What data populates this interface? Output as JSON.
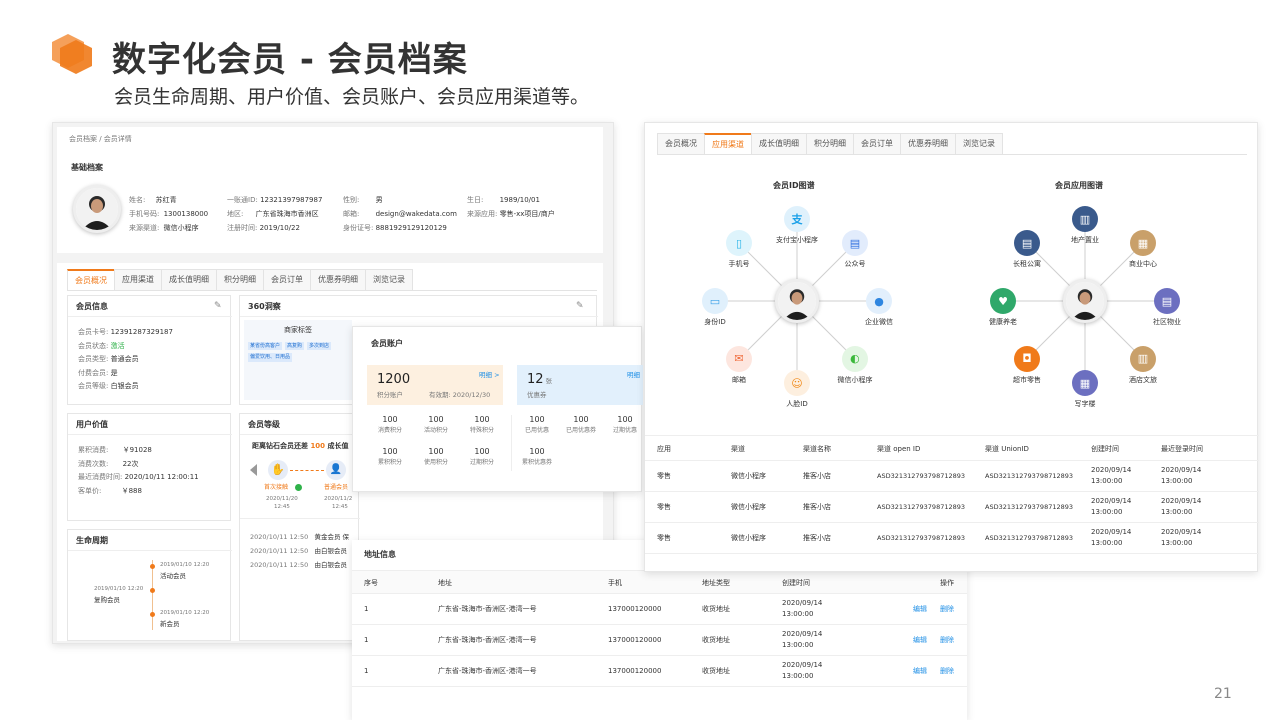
{
  "slide": {
    "title": "数字化会员 - 会员档案",
    "subtitle": "会员生命周期、用户价值、会员账户、会员应用渠道等。",
    "page_number": "21",
    "accent": "#f07a1a"
  },
  "left": {
    "breadcrumb": "会员档案 / 会员详情",
    "basic_title": "基础档案",
    "profile": {
      "name_label": "姓名:",
      "name": "苏红青",
      "phone_label": "手机号码:",
      "phone": "1300138000",
      "source_label": "来源渠道:",
      "source": "微信小程序",
      "id_label": "一账通ID:",
      "id": "12321397987987",
      "region_label": "地区:",
      "region": "广东省珠海市香洲区",
      "reg_label": "注册时间:",
      "reg": "2019/10/22",
      "gender_label": "性别:",
      "gender": "男",
      "email_label": "邮箱:",
      "email": "design@wakedata.com",
      "idcard_label": "身份证号:",
      "idcard": "8881929129120129",
      "birth_label": "生日:",
      "birth": "1989/10/01",
      "app_label": "来源应用:",
      "app": "零售-xx项目/商户"
    },
    "tabs": [
      "会员概况",
      "应用渠道",
      "成长值明细",
      "积分明细",
      "会员订单",
      "优惠券明细",
      "浏览记录"
    ],
    "member_info": {
      "title": "会员信息",
      "rows": [
        {
          "k": "会员卡号:",
          "v": "12391287329187"
        },
        {
          "k": "会员状态:",
          "v": "激活"
        },
        {
          "k": "会员类型:",
          "v": "普通会员"
        },
        {
          "k": "付费会员:",
          "v": "是"
        },
        {
          "k": "会员等级:",
          "v": "白银会员"
        }
      ]
    },
    "insight": {
      "title": "360洞察",
      "tag_title": "商家标签",
      "tags": [
        "某省份高客户",
        "高复购",
        "多次到店",
        "偏爱饮用、日用品"
      ]
    },
    "user_value": {
      "title": "用户价值",
      "rows": [
        {
          "k": "累积消费:",
          "v": "￥91028"
        },
        {
          "k": "消费次数:",
          "v": "22次"
        },
        {
          "k": "最近消费时间:",
          "v": "2020/10/11 12:00:11"
        },
        {
          "k": "客单价:",
          "v": "￥888"
        }
      ]
    },
    "level": {
      "title": "会员等级",
      "hint_prefix": "距离钻石会员还差",
      "hint_value": "100",
      "hint_suffix": "成长值",
      "step1": "首次接触",
      "step1_date": "2020/11/20",
      "step1_time": "12:45",
      "step2": "普通会员",
      "step2_date": "2020/11/2",
      "step2_time": "12:45",
      "log": [
        {
          "time": "2020/10/11 12:50",
          "text": "黄金会员 保"
        },
        {
          "time": "2020/10/11 12:50",
          "text": "由白银会员"
        },
        {
          "time": "2020/10/11 12:50",
          "text": "由白银会员"
        }
      ]
    },
    "lifecycle": {
      "title": "生命周期",
      "events": [
        {
          "time": "2019/01/10 12:20",
          "text": "活动会员"
        },
        {
          "time": "2019/01/10 12:20",
          "text": "复购会员"
        },
        {
          "time": "2019/01/10 12:20",
          "text": "新会员"
        }
      ]
    }
  },
  "account": {
    "title": "会员账户",
    "points_value": "1200",
    "points_label": "积分账户",
    "points_expiry": "有效期: 2020/12/30",
    "detail_link": "明细 >",
    "coupon_value": "12",
    "coupon_unit": "张",
    "coupon_label": "优惠券",
    "coupon_link": "明细",
    "points_stats": [
      {
        "v": "100",
        "k": "消费积分"
      },
      {
        "v": "100",
        "k": "活动积分"
      },
      {
        "v": "100",
        "k": "特殊积分"
      },
      {
        "v": "100",
        "k": "累积积分"
      },
      {
        "v": "100",
        "k": "使用积分"
      },
      {
        "v": "100",
        "k": "过期积分"
      }
    ],
    "coupon_stats": [
      {
        "v": "100",
        "k": "已用优惠"
      },
      {
        "v": "100",
        "k": "已用优惠券"
      },
      {
        "v": "100",
        "k": "过期优惠"
      },
      {
        "v": "100",
        "k": "累积优惠券"
      }
    ]
  },
  "address": {
    "title": "地址信息",
    "headers": [
      "序号",
      "地址",
      "手机",
      "地址类型",
      "创建时间",
      "操作"
    ],
    "rows": [
      {
        "no": "1",
        "addr": "广东省-珠海市-香洲区-港湾一号",
        "phone": "137000120000",
        "type": "收货地址",
        "date": "2020/09/14",
        "time": "13:00:00",
        "edit": "编辑",
        "del": "删除"
      },
      {
        "no": "1",
        "addr": "广东省-珠海市-香洲区-港湾一号",
        "phone": "137000120000",
        "type": "收货地址",
        "date": "2020/09/14",
        "time": "13:00:00",
        "edit": "编辑",
        "del": "删除"
      },
      {
        "no": "1",
        "addr": "广东省-珠海市-香洲区-港湾一号",
        "phone": "137000120000",
        "type": "收货地址",
        "date": "2020/09/14",
        "time": "13:00:00",
        "edit": "编辑",
        "del": "删除"
      }
    ]
  },
  "right": {
    "tabs": [
      "会员概况",
      "应用渠道",
      "成长值明细",
      "积分明细",
      "会员订单",
      "优惠券明细",
      "浏览记录"
    ],
    "id_graph": {
      "title": "会员ID图谱",
      "nodes": [
        {
          "label": "支付宝小程序",
          "color": "#1aa0e8",
          "bg": "#dff1fc",
          "icon": "alipay-icon"
        },
        {
          "label": "公众号",
          "color": "#2f6fe0",
          "bg": "#e2ecfc",
          "icon": "official-account-icon"
        },
        {
          "label": "企业微信",
          "color": "#2f86e0",
          "bg": "#e2effc",
          "icon": "wecom-icon"
        },
        {
          "label": "微信小程序",
          "color": "#3cb83c",
          "bg": "#e3f6e3",
          "icon": "wechat-icon"
        },
        {
          "label": "人脸ID",
          "color": "#f08a1a",
          "bg": "#fdefdf",
          "icon": "face-id-icon"
        },
        {
          "label": "邮箱",
          "color": "#f06a3a",
          "bg": "#fde6df",
          "icon": "mail-icon"
        },
        {
          "label": "身份ID",
          "color": "#38a0e8",
          "bg": "#e0f0fc",
          "icon": "id-card-icon"
        },
        {
          "label": "手机号",
          "color": "#28b4e8",
          "bg": "#def4fc",
          "icon": "phone-icon"
        }
      ]
    },
    "app_graph": {
      "title": "会员应用图谱",
      "nodes": [
        {
          "label": "地产置业",
          "color": "#3a5a8c",
          "icon": "building-icon"
        },
        {
          "label": "商业中心",
          "color": "#c9a06a",
          "icon": "mall-icon"
        },
        {
          "label": "社区物业",
          "color": "#6c6fc0",
          "icon": "community-icon"
        },
        {
          "label": "酒店文旅",
          "color": "#c9a06a",
          "icon": "hotel-icon"
        },
        {
          "label": "写字楼",
          "color": "#6c6fc0",
          "icon": "office-icon"
        },
        {
          "label": "超市零售",
          "color": "#f07a1a",
          "icon": "supermarket-icon"
        },
        {
          "label": "健康养老",
          "color": "#2fa86a",
          "icon": "health-icon"
        },
        {
          "label": "长租公寓",
          "color": "#3a5a8c",
          "icon": "apartment-icon"
        }
      ]
    },
    "table": {
      "headers": [
        "应用",
        "渠道",
        "渠道名称",
        "渠道 open ID",
        "渠道 UnionID",
        "创建时间",
        "最近登录时间"
      ],
      "rows": [
        {
          "app": "零售",
          "channel": "微信小程序",
          "name": "推客小店",
          "openid": "ASD321312793798712893",
          "unionid": "ASD321312793798712893",
          "c_date": "2020/09/14",
          "c_time": "13:00:00",
          "l_date": "2020/09/14",
          "l_time": "13:00:00"
        },
        {
          "app": "零售",
          "channel": "微信小程序",
          "name": "推客小店",
          "openid": "ASD321312793798712893",
          "unionid": "ASD321312793798712893",
          "c_date": "2020/09/14",
          "c_time": "13:00:00",
          "l_date": "2020/09/14",
          "l_time": "13:00:00"
        },
        {
          "app": "零售",
          "channel": "微信小程序",
          "name": "推客小店",
          "openid": "ASD321312793798712893",
          "unionid": "ASD321312793798712893",
          "c_date": "2020/09/14",
          "c_time": "13:00:00",
          "l_date": "2020/09/14",
          "l_time": "13:00:00"
        }
      ]
    }
  }
}
